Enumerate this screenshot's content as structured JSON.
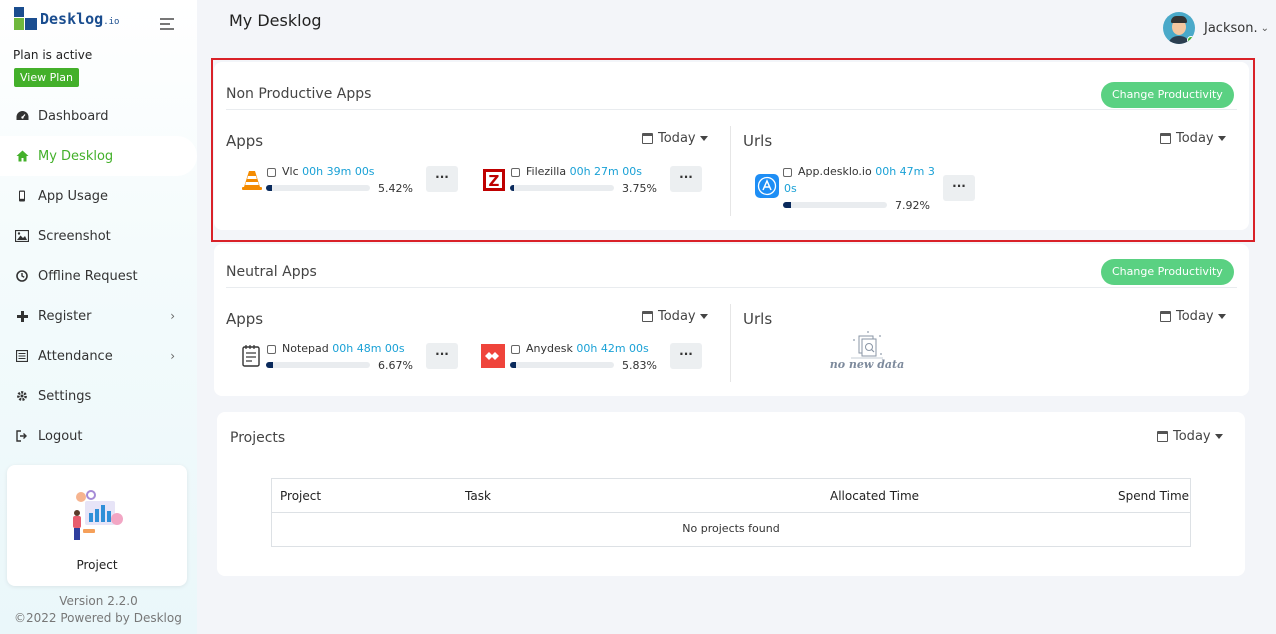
{
  "sidebar": {
    "logo_text": "Desklog",
    "logo_suffix": ".io",
    "plan_status": "Plan is active",
    "view_plan_label": "View Plan",
    "items": [
      {
        "label": "Dashboard",
        "icon": "dashboard-icon"
      },
      {
        "label": "My Desklog",
        "icon": "home-icon"
      },
      {
        "label": "App Usage",
        "icon": "mobile-icon"
      },
      {
        "label": "Screenshot",
        "icon": "image-icon"
      },
      {
        "label": "Offline Request",
        "icon": "clock-icon"
      },
      {
        "label": "Register",
        "icon": "plus-icon"
      },
      {
        "label": "Attendance",
        "icon": "calendar-list-icon"
      },
      {
        "label": "Settings",
        "icon": "gear-icon"
      },
      {
        "label": "Logout",
        "icon": "logout-icon"
      }
    ],
    "project_card_label": "Project",
    "version": "Version 2.2.0",
    "powered_by": "©2022 Powered by Desklog",
    "accent_color": "#43b02a"
  },
  "header": {
    "title": "My Desklog",
    "user_name": "Jackson."
  },
  "non_productive": {
    "title": "Non Productive Apps",
    "change_label": "Change Productivity",
    "apps_title": "Apps",
    "urls_title": "Urls",
    "apps_filter": "Today",
    "urls_filter": "Today",
    "apps": [
      {
        "name": "Vlc",
        "time": "00h 39m 00s",
        "percent": "5.42%",
        "fill": 5.42,
        "icon": "vlc-icon"
      },
      {
        "name": "Filezilla",
        "time": "00h 27m 00s",
        "percent": "3.75%",
        "fill": 3.75,
        "icon": "filezilla-icon"
      }
    ],
    "urls": [
      {
        "name": "App.desklo.io",
        "time_part1": "00h 47m 3",
        "time_part2": "0s",
        "percent": "7.92%",
        "fill": 7.92,
        "icon": "app-store-icon"
      }
    ]
  },
  "neutral": {
    "title": "Neutral Apps",
    "change_label": "Change Productivity",
    "apps_title": "Apps",
    "urls_title": "Urls",
    "apps_filter": "Today",
    "urls_filter": "Today",
    "apps": [
      {
        "name": "Notepad",
        "time": "00h 48m 00s",
        "percent": "6.67%",
        "fill": 6.67,
        "icon": "notepad-icon"
      },
      {
        "name": "Anydesk",
        "time": "00h 42m 00s",
        "percent": "5.83%",
        "fill": 5.83,
        "icon": "anydesk-icon"
      }
    ],
    "no_data_text": "no new data"
  },
  "projects": {
    "title": "Projects",
    "filter": "Today",
    "columns": [
      "Project",
      "Task",
      "Allocated Time",
      "Spend Time"
    ],
    "empty_text": "No projects found"
  }
}
